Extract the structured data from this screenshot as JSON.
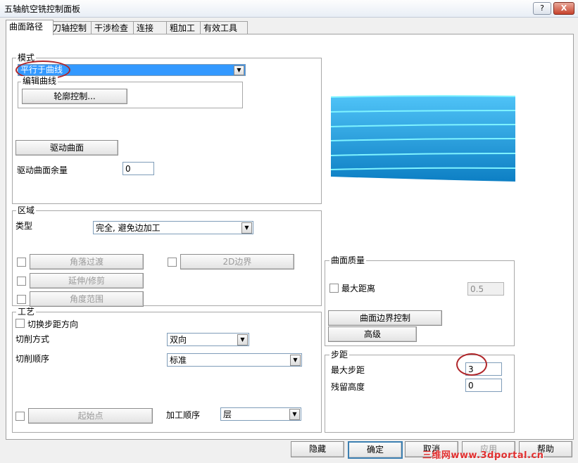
{
  "window": {
    "title": "五轴航空铣控制面板",
    "help_btn": "?",
    "close_btn": "X"
  },
  "tabs": [
    "曲面路径",
    "刀轴控制",
    "干涉检查",
    "连接",
    "粗加工",
    "有效工具"
  ],
  "mode": {
    "group_label": "模式",
    "selected": "平行于曲线",
    "edit_curve_label": "编辑曲线",
    "profile_button": "轮廓控制..."
  },
  "drive": {
    "drive_surface_button": "驱动曲面",
    "allowance_label": "驱动曲面余量",
    "allowance_value": "0"
  },
  "region": {
    "group_label": "区域",
    "type_label": "类型",
    "type_value": "完全, 避免边加工",
    "corner_button": "角落过渡",
    "boundary_2d_button": "2D边界",
    "extend_button": "延伸/修剪",
    "angle_button": "角度范围"
  },
  "process": {
    "group_label": "工艺",
    "switch_step_label": "切换步距方向",
    "cut_method_label": "切削方式",
    "cut_method_value": "双向",
    "cut_order_label": "切削顺序",
    "cut_order_value": "标准",
    "start_point_button": "起始点",
    "machining_order_label": "加工顺序",
    "machining_order_value": "层"
  },
  "surface_quality": {
    "group_label": "曲面质量",
    "max_distance_label": "最大距离",
    "max_distance_value": "0.5",
    "edge_control_button": "曲面边界控制",
    "advanced_button": "高级"
  },
  "stepover": {
    "group_label": "步距",
    "max_step_label": "最大步距",
    "max_step_value": "3",
    "scallop_label": "残留高度",
    "scallop_value": "0"
  },
  "footer": {
    "hide": "隐藏",
    "ok": "确定",
    "cancel": "取消",
    "apply": "应用",
    "help": "帮助"
  },
  "watermark": "三维网www.3dportal.cn",
  "colors": {
    "surface": "#1aa0e0",
    "selection": "#3399ff",
    "highlight_circle": "#b0262a"
  }
}
